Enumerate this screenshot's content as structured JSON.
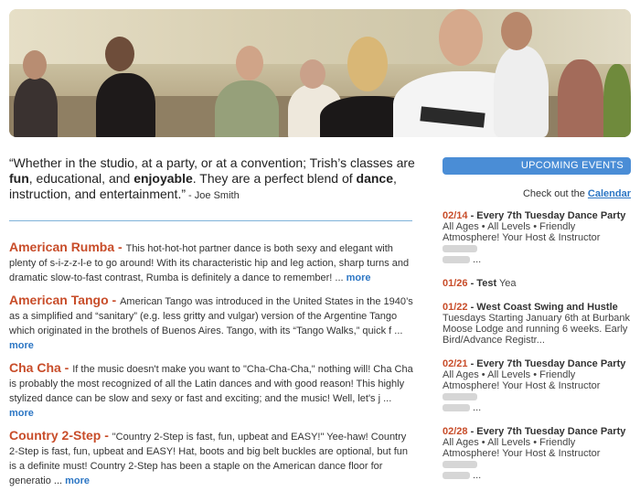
{
  "quote": {
    "p1": "“Whether in the studio, at a party, or at a convention; Trish’s classes are ",
    "fun": "fun",
    "p2": ", educational, and ",
    "enjoyable": "enjoyable",
    "p3": ". They are a perfect blend of ",
    "dance": "dance",
    "p4": ", instruction, and entertainment.”",
    "attribution": " - Joe Smith"
  },
  "dances": [
    {
      "name": "American Rumba - ",
      "desc": "This hot-hot-hot partner dance is both sexy and elegant with plenty of s-i-z-z-l-e to go around! With its characteristic hip and leg action, sharp turns and dramatic slow-to-fast contrast, Rumba is definitely a dance to remember! ... ",
      "more": "more"
    },
    {
      "name": "American Tango - ",
      "desc": "American Tango was introduced in the United States in the 1940’s as a simplified and “sanitary” (e.g. less gritty and vulgar) version of the Argentine Tango which originated in the brothels of Buenos Aires. Tango, with its “Tango Walks,” quick f ... ",
      "more": "more"
    },
    {
      "name": "Cha Cha - ",
      "desc": "If the music doesn't make you want to \"Cha-Cha-Cha,\" nothing will! Cha Cha is probably the most recognized of all the Latin dances and with good reason! This highly stylized dance can be slow and sexy or fast and exciting; and the music! Well, let's j ... ",
      "more": "more"
    },
    {
      "name": "Country 2-Step - ",
      "desc": "\"Country 2-Step is fast, fun, upbeat and EASY!\" Yee-haw! Country 2-Step is fast, fun, upbeat and EASY! Hat, boots and big belt buckles are optional, but fun is a definite must! Country 2-Step has been a staple on the American dance floor for generatio ... ",
      "more": "more"
    }
  ],
  "sidebar": {
    "upcoming_label": "UPCOMING EVENTS",
    "check_prefix": "Check out the ",
    "calendar_link": "Calendar"
  },
  "events": [
    {
      "date": "02/14",
      "title": " - Every 7th Tuesday Dance Party",
      "text": "All Ages • All Levels • Friendly Atmosphere!   Your Host & Instructor",
      "tail": " ..."
    },
    {
      "date": "01/26",
      "title": " - Test",
      "text": "Yea",
      "tail": ""
    },
    {
      "date": "01/22",
      "title": " - West Coast Swing and Hustle",
      "text": "Tuesdays Starting January 6th at Burbank Moose Lodge and running 6 weeks. Early Bird/Advance Registr...",
      "tail": ""
    },
    {
      "date": "02/21",
      "title": " - Every 7th Tuesday Dance Party",
      "text": "All Ages • All Levels • Friendly Atmosphere!   Your Host & Instructor",
      "tail": " ..."
    },
    {
      "date": "02/28",
      "title": " - Every 7th Tuesday Dance Party",
      "text": "All Ages • All Levels • Friendly Atmosphere!   Your Host & Instructor",
      "tail": " ..."
    }
  ]
}
